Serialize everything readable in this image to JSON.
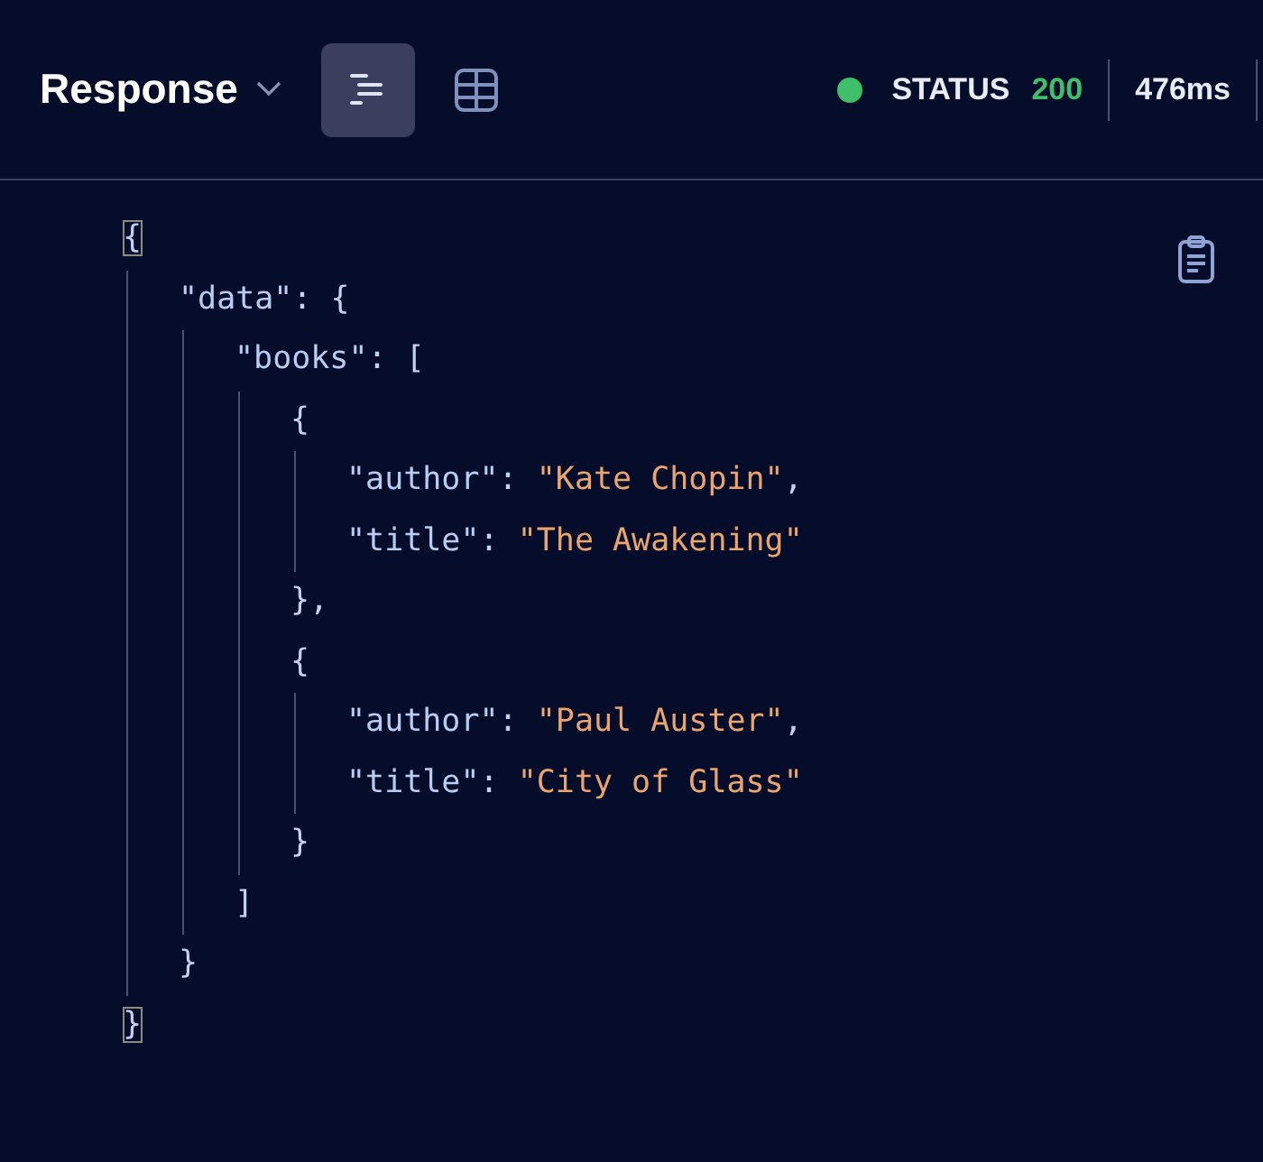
{
  "header": {
    "title": "Response",
    "view_toggles": [
      {
        "kind": "pretty",
        "selected": true
      },
      {
        "kind": "table",
        "selected": false
      }
    ],
    "status": {
      "label": "STATUS",
      "code": "200",
      "color": "#3fbf6a",
      "time": "476ms"
    }
  },
  "body": {
    "tree": {
      "line": [
        {
          "kind": "punct",
          "text": "{",
          "highlighted": true
        }
      ],
      "children": [
        {
          "line": [
            {
              "kind": "key",
              "text": "\"data\""
            },
            {
              "kind": "punct",
              "text": ": {"
            }
          ],
          "children": [
            {
              "line": [
                {
                  "kind": "key",
                  "text": "\"books\""
                },
                {
                  "kind": "punct",
                  "text": ": ["
                }
              ],
              "children": [
                {
                  "line": [
                    {
                      "kind": "punct",
                      "text": "{"
                    }
                  ],
                  "children": [
                    {
                      "line": [
                        {
                          "kind": "key",
                          "text": "\"author\""
                        },
                        {
                          "kind": "punct",
                          "text": ": "
                        },
                        {
                          "kind": "string",
                          "text": "\"Kate Chopin\""
                        },
                        {
                          "kind": "punct",
                          "text": ","
                        }
                      ]
                    },
                    {
                      "line": [
                        {
                          "kind": "key",
                          "text": "\"title\""
                        },
                        {
                          "kind": "punct",
                          "text": ": "
                        },
                        {
                          "kind": "string",
                          "text": "\"The Awakening\""
                        }
                      ]
                    }
                  ],
                  "close": [
                    {
                      "kind": "punct",
                      "text": "},"
                    }
                  ]
                },
                {
                  "line": [
                    {
                      "kind": "punct",
                      "text": "{"
                    }
                  ],
                  "children": [
                    {
                      "line": [
                        {
                          "kind": "key",
                          "text": "\"author\""
                        },
                        {
                          "kind": "punct",
                          "text": ": "
                        },
                        {
                          "kind": "string",
                          "text": "\"Paul Auster\""
                        },
                        {
                          "kind": "punct",
                          "text": ","
                        }
                      ]
                    },
                    {
                      "line": [
                        {
                          "kind": "key",
                          "text": "\"title\""
                        },
                        {
                          "kind": "punct",
                          "text": ": "
                        },
                        {
                          "kind": "string",
                          "text": "\"City of Glass\""
                        }
                      ]
                    }
                  ],
                  "close": [
                    {
                      "kind": "punct",
                      "text": "}"
                    }
                  ]
                }
              ],
              "close": [
                {
                  "kind": "punct",
                  "text": "]"
                }
              ]
            }
          ],
          "close": [
            {
              "kind": "punct",
              "text": "}"
            }
          ]
        }
      ],
      "close": [
        {
          "kind": "punct",
          "text": "}",
          "highlighted": true
        }
      ]
    }
  }
}
